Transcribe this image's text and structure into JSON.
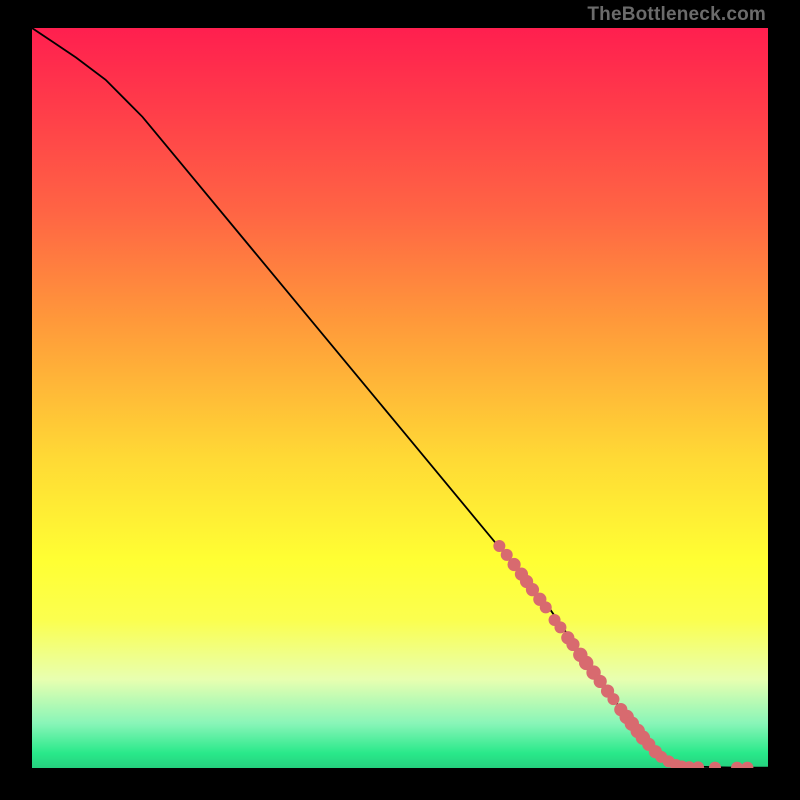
{
  "watermark": "TheBottleneck.com",
  "chart_data": {
    "type": "line",
    "title": "",
    "xlabel": "",
    "ylabel": "",
    "xlim": [
      0,
      100
    ],
    "ylim": [
      0,
      100
    ],
    "grid": false,
    "legend": false,
    "series": [
      {
        "name": "curve",
        "x": [
          0,
          3,
          6,
          10,
          15,
          20,
          30,
          40,
          50,
          60,
          70,
          77,
          80,
          82,
          84,
          86,
          88,
          90,
          93,
          96,
          100
        ],
        "y": [
          100,
          98,
          96,
          93,
          88,
          82,
          70,
          58,
          46,
          34,
          22,
          12,
          8,
          5,
          3,
          1.5,
          0.6,
          0.2,
          0.1,
          0.05,
          0.05
        ]
      }
    ],
    "markers": [
      {
        "x": 63.5,
        "y": 30,
        "r": 1.0
      },
      {
        "x": 64.5,
        "y": 28.8,
        "r": 1.0
      },
      {
        "x": 65.5,
        "y": 27.5,
        "r": 1.1
      },
      {
        "x": 66.5,
        "y": 26.2,
        "r": 1.1
      },
      {
        "x": 67.2,
        "y": 25.2,
        "r": 1.1
      },
      {
        "x": 68.0,
        "y": 24.1,
        "r": 1.1
      },
      {
        "x": 69.0,
        "y": 22.8,
        "r": 1.1
      },
      {
        "x": 69.8,
        "y": 21.7,
        "r": 1.0
      },
      {
        "x": 71.0,
        "y": 20.0,
        "r": 1.0
      },
      {
        "x": 71.8,
        "y": 19.0,
        "r": 1.0
      },
      {
        "x": 72.8,
        "y": 17.6,
        "r": 1.1
      },
      {
        "x": 73.5,
        "y": 16.7,
        "r": 1.1
      },
      {
        "x": 74.5,
        "y": 15.3,
        "r": 1.2
      },
      {
        "x": 75.3,
        "y": 14.2,
        "r": 1.2
      },
      {
        "x": 76.3,
        "y": 12.9,
        "r": 1.2
      },
      {
        "x": 77.2,
        "y": 11.7,
        "r": 1.1
      },
      {
        "x": 78.2,
        "y": 10.4,
        "r": 1.1
      },
      {
        "x": 79.0,
        "y": 9.3,
        "r": 1.0
      },
      {
        "x": 80.0,
        "y": 7.9,
        "r": 1.1
      },
      {
        "x": 80.8,
        "y": 6.9,
        "r": 1.2
      },
      {
        "x": 81.5,
        "y": 6.0,
        "r": 1.2
      },
      {
        "x": 82.3,
        "y": 5.0,
        "r": 1.2
      },
      {
        "x": 83.0,
        "y": 4.1,
        "r": 1.2
      },
      {
        "x": 83.8,
        "y": 3.2,
        "r": 1.1
      },
      {
        "x": 84.7,
        "y": 2.2,
        "r": 1.1
      },
      {
        "x": 85.5,
        "y": 1.5,
        "r": 1.0
      },
      {
        "x": 86.5,
        "y": 0.9,
        "r": 1.0
      },
      {
        "x": 87.5,
        "y": 0.4,
        "r": 1.0
      },
      {
        "x": 88.3,
        "y": 0.2,
        "r": 1.0
      },
      {
        "x": 89.3,
        "y": 0.1,
        "r": 1.0
      },
      {
        "x": 90.5,
        "y": 0.08,
        "r": 1.0
      },
      {
        "x": 92.8,
        "y": 0.05,
        "r": 1.0
      },
      {
        "x": 95.8,
        "y": 0.05,
        "r": 1.0
      },
      {
        "x": 97.2,
        "y": 0.05,
        "r": 1.0
      }
    ]
  }
}
